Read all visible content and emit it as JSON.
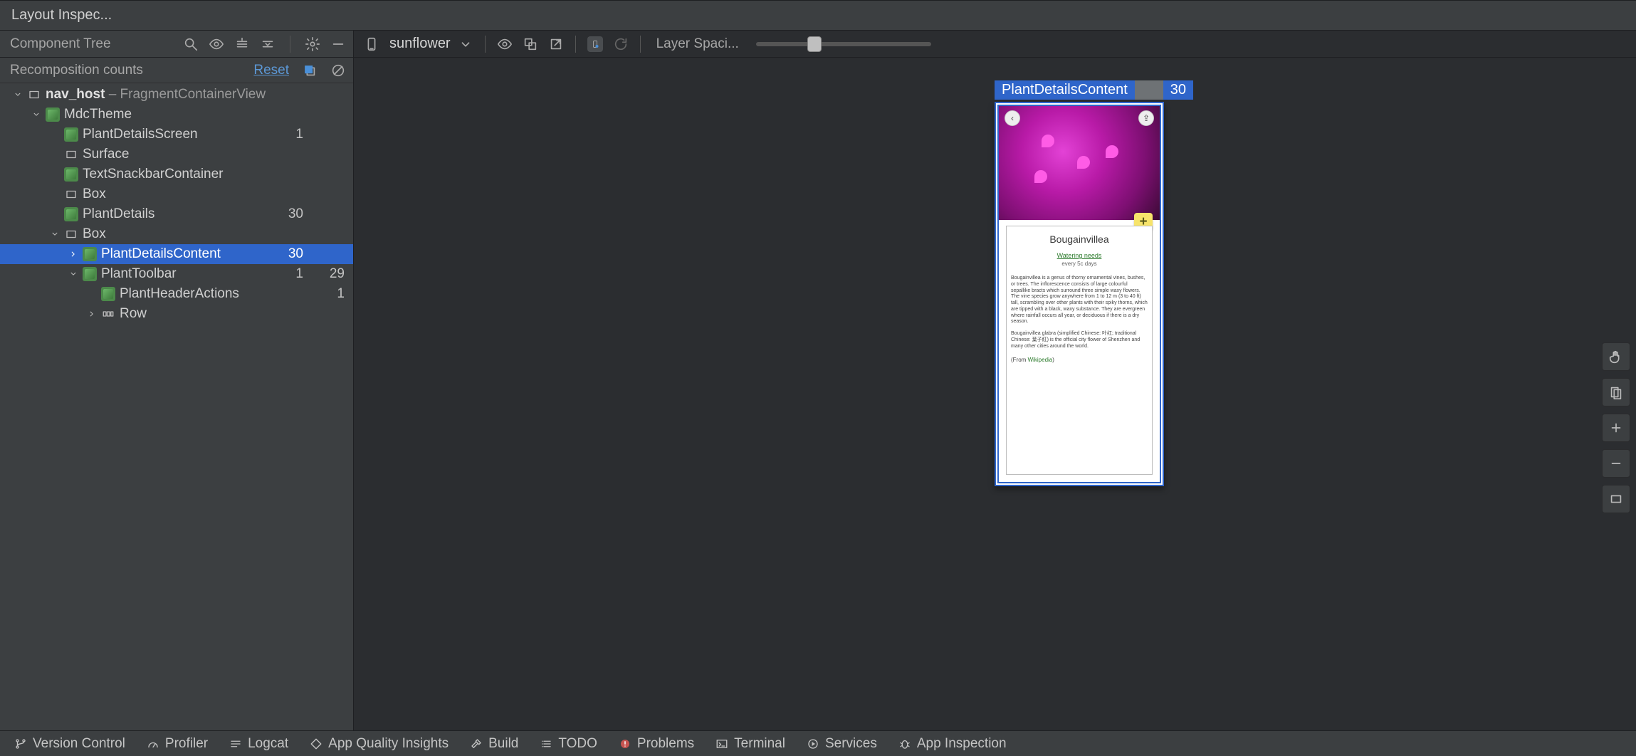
{
  "titlebar": {
    "title": "Layout Inspec..."
  },
  "left": {
    "toolbar_label": "Component Tree",
    "recomp_label": "Recomposition counts",
    "reset_label": "Reset"
  },
  "tree": {
    "rows": [
      {
        "indent": 0,
        "arrow": "down",
        "icon": "container",
        "label_bold": "nav_host",
        "label_dim": " – FragmentContainerView",
        "c1": "",
        "c2": ""
      },
      {
        "indent": 1,
        "arrow": "down",
        "icon": "compose",
        "label": "MdcTheme",
        "c1": "",
        "c2": ""
      },
      {
        "indent": 2,
        "arrow": "none",
        "icon": "compose",
        "label": "PlantDetailsScreen",
        "c1": "1",
        "c2": ""
      },
      {
        "indent": 2,
        "arrow": "none",
        "icon": "container",
        "label": "Surface",
        "c1": "",
        "c2": ""
      },
      {
        "indent": 2,
        "arrow": "none",
        "icon": "compose",
        "label": "TextSnackbarContainer",
        "c1": "",
        "c2": ""
      },
      {
        "indent": 2,
        "arrow": "none",
        "icon": "container",
        "label": "Box",
        "c1": "",
        "c2": ""
      },
      {
        "indent": 2,
        "arrow": "none",
        "icon": "compose",
        "label": "PlantDetails",
        "c1": "30",
        "c2": ""
      },
      {
        "indent": 2,
        "arrow": "down",
        "icon": "container",
        "label": "Box",
        "c1": "",
        "c2": ""
      },
      {
        "indent": 3,
        "arrow": "right",
        "icon": "compose",
        "label": "PlantDetailsContent",
        "c1": "30",
        "c2": "",
        "selected": true
      },
      {
        "indent": 3,
        "arrow": "down",
        "icon": "compose",
        "label": "PlantToolbar",
        "c1": "1",
        "c2": "29"
      },
      {
        "indent": 4,
        "arrow": "none",
        "icon": "compose",
        "label": "PlantHeaderActions",
        "c1": "",
        "c2": "1"
      },
      {
        "indent": 4,
        "arrow": "right",
        "icon": "row",
        "label": "Row",
        "c1": "",
        "c2": ""
      }
    ]
  },
  "right": {
    "device_name": "sunflower",
    "slider_label": "Layer Spaci...",
    "badge_name": "PlantDetailsContent",
    "badge_count": "30"
  },
  "plant_card": {
    "title": "Bougainvillea",
    "sub": "Watering needs",
    "sub2": "every 5c days",
    "p1": "Bougainvillea is a genus of thorny ornamental vines, bushes, or trees. The inflorescence consists of large colourful sepallike bracts which surround three simple waxy flowers. The vine species grow anywhere from 1 to 12 m (3 to 40 ft) tall, scrambling over other plants with their spiky thorns, which are tipped with a black, waxy substance. They are evergreen where rainfall occurs all year, or deciduous if there is a dry season.",
    "p2": "Bougainvillea glabra (simplified Chinese: 叶红; traditional Chinese: 葉子紅) is the official city flower of Shenzhen and many other cities around the world.",
    "from_prefix": "(From ",
    "from_link": "Wikipedia",
    "from_suffix": ")"
  },
  "bottom": {
    "items": [
      {
        "icon": "branch",
        "label": "Version Control"
      },
      {
        "icon": "gauge",
        "label": "Profiler"
      },
      {
        "icon": "log",
        "label": "Logcat"
      },
      {
        "icon": "diamond",
        "label": "App Quality Insights"
      },
      {
        "icon": "hammer",
        "label": "Build"
      },
      {
        "icon": "list",
        "label": "TODO"
      },
      {
        "icon": "warn",
        "label": "Problems"
      },
      {
        "icon": "terminal",
        "label": "Terminal"
      },
      {
        "icon": "play",
        "label": "Services"
      },
      {
        "icon": "bug",
        "label": "App Inspection"
      }
    ]
  }
}
